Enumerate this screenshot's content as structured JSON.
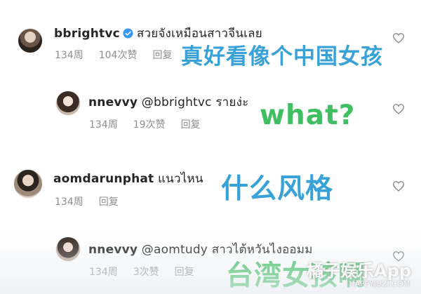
{
  "comments": [
    {
      "username": "bbrightvc",
      "verified": true,
      "text": "สวยจังเหมือนสาวจีนเลย",
      "time": "134周",
      "likes": "104次赞",
      "reply": "回复",
      "overlay": "真好看像个中国女孩"
    },
    {
      "username": "nnevvy",
      "mention": "@bbrightvc",
      "text": "รายง่ะ",
      "time": "134周",
      "likes": "19次赞",
      "reply": "回复",
      "overlay": "what?"
    },
    {
      "username": "aomdarunphat",
      "text": "แนวไหน",
      "time": "134周",
      "reply": "回复",
      "overlay": "什么风格"
    },
    {
      "username": "nnevvy",
      "mention": "@aomtudy",
      "text": "สาวไต้หวันไงออมม",
      "time": "134周",
      "likes": "3次赞",
      "reply": "回复",
      "overlay": "台湾女孩啊"
    }
  ],
  "watermark": {
    "logo": "橘子娱乐App",
    "url": "HAPPYJUZI.COM"
  },
  "colors": {
    "overlay_blue": "#38a2d8",
    "overlay_green": "#3fbf62",
    "meta_gray": "#8e8e8e",
    "verified_blue": "#3897f0"
  }
}
